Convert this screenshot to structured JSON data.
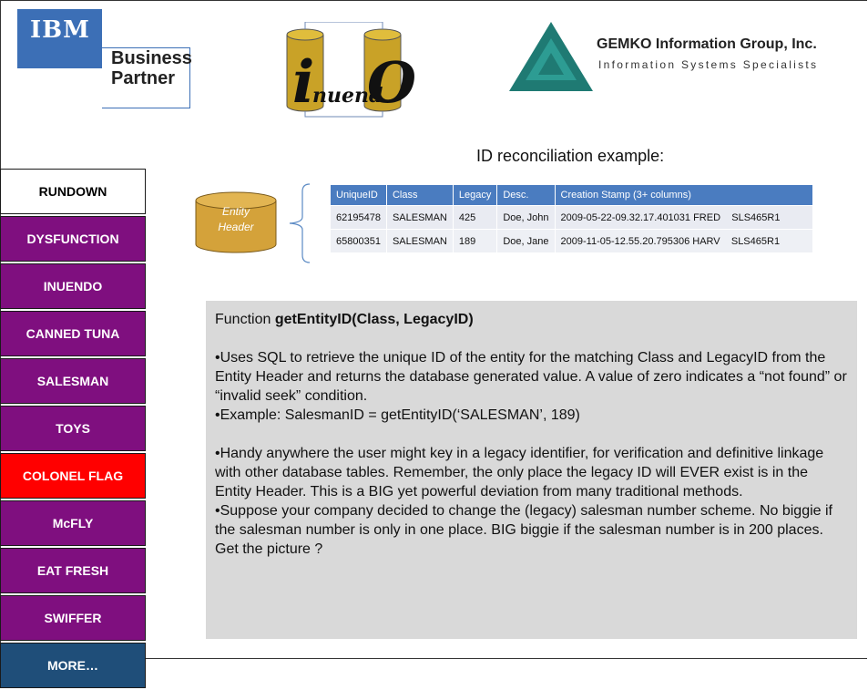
{
  "logos": {
    "ibm": {
      "brand": "IBM",
      "line1": "Business",
      "line2": "Partner",
      "color": "#3c6fb6"
    },
    "inuendo": {
      "text": "InuendO",
      "color": "#c9a227"
    },
    "gemko": {
      "title": "GEMKO Information Group, Inc.",
      "subtitle": "Information Systems Specialists",
      "color": "#1f7a73"
    }
  },
  "heading": "ID reconciliation example:",
  "nav": {
    "items": [
      {
        "label": "RUNDOWN",
        "color": "#ffffff",
        "text_color": "#000000"
      },
      {
        "label": "DYSFUNCTION",
        "color": "#7f0f7f",
        "text_color": "#ffffff"
      },
      {
        "label": "INUENDO",
        "color": "#7f0f7f",
        "text_color": "#ffffff"
      },
      {
        "label": "CANNED TUNA",
        "color": "#7f0f7f",
        "text_color": "#ffffff"
      },
      {
        "label": "SALESMAN",
        "color": "#7f0f7f",
        "text_color": "#ffffff"
      },
      {
        "label": "TOYS",
        "color": "#7f0f7f",
        "text_color": "#ffffff"
      },
      {
        "label": "COLONEL FLAG",
        "color": "#ff0000",
        "text_color": "#ffffff"
      },
      {
        "label": "McFLY",
        "color": "#7f0f7f",
        "text_color": "#ffffff"
      },
      {
        "label": "EAT FRESH",
        "color": "#7f0f7f",
        "text_color": "#ffffff"
      },
      {
        "label": "SWIFFER",
        "color": "#7f0f7f",
        "text_color": "#ffffff"
      },
      {
        "label": "MORE…",
        "color": "#1f4e79",
        "text_color": "#ffffff"
      }
    ]
  },
  "entity": {
    "line1": "Entity",
    "line2": "Header"
  },
  "table": {
    "headers": [
      "UniqueID",
      "Class",
      "Legacy",
      "Desc.",
      "Creation Stamp (3+ columns)"
    ],
    "rows": [
      [
        "62195478",
        "SALESMAN",
        "425",
        "Doe, John",
        "2009-05-22-09.32.17.401031 FRED    SLS465R1"
      ],
      [
        "65800351",
        "SALESMAN",
        "189",
        "Doe, Jane",
        "2009-11-05-12.55.20.795306 HARV    SLS465R1"
      ]
    ]
  },
  "box": {
    "title_prefix": "Function ",
    "title_bold": "getEntityID(Class, LegacyID)",
    "p1": "•Uses SQL to retrieve the unique ID of the entity for the matching Class and LegacyID from the Entity Header and returns the database generated value. A value of zero indicates a “not found” or “invalid seek” condition.",
    "p2": "•Example:  SalesmanID = getEntityID(‘SALESMAN’, 189)",
    "p3": "•Handy anywhere the user might key in a legacy identifier, for verification and definitive linkage with other database tables.  Remember, the only place the legacy ID will EVER exist is in the Entity Header.  This is a BIG yet powerful deviation from many traditional methods.",
    "p4": "•Suppose your company decided to change the (legacy) salesman number scheme.  No biggie if the salesman number is only in one place.  BIG biggie if the salesman number is in 200 places.  Get the picture ?"
  }
}
